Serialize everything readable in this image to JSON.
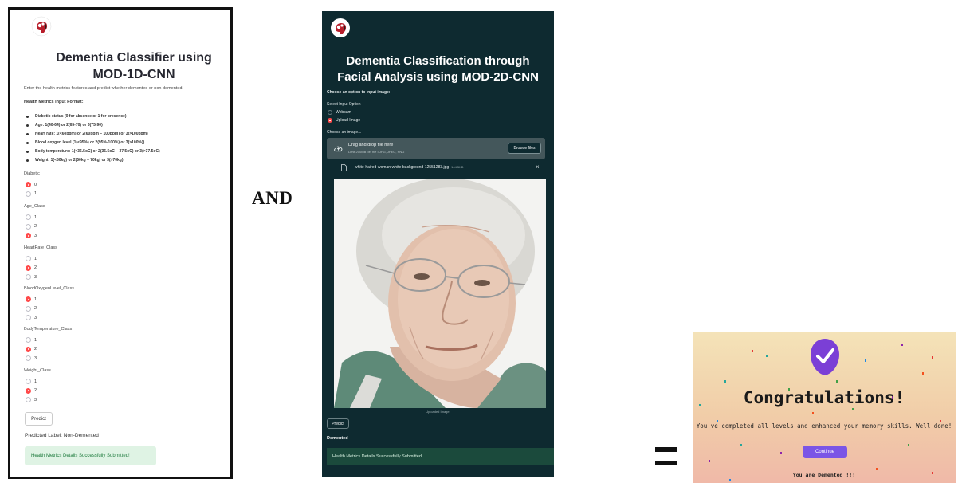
{
  "and_text": "AND",
  "left": {
    "title_line1": "Dementia Classifier using",
    "title_line2": "MOD-1D-CNN",
    "intro": "Enter the health metrics features and predict whether demented or non demented.",
    "format_heading": "Health Metrics Input Format:",
    "format_items": [
      "Diabetic status (0 for absence or 1 for presence)",
      "Age: 1(40-64) or 2(65-70) or 3(75-90)",
      "Heart rate: 1(<60bpm) or 2(60bpm – 100bpm) or 3(>100bpm)",
      "Blood oxygen level (1(<95%) or 2(95%-100%) or 3(>100%))",
      "Body temperature: 1(<36.5oC) or 2(36.5oC – 37.5oC) or 3(>37.5oC)",
      "Weight: 1(<50kg) or 2(50kg – 70kg) or 3(>70kg)"
    ],
    "groups": [
      {
        "label": "Diabetic",
        "options": [
          "0",
          "1"
        ],
        "selected": 0
      },
      {
        "label": "Age_Class",
        "options": [
          "1",
          "2",
          "3"
        ],
        "selected": 2
      },
      {
        "label": "HeartRate_Class",
        "options": [
          "1",
          "2",
          "3"
        ],
        "selected": 1
      },
      {
        "label": "BloodOxygenLevel_Class",
        "options": [
          "1",
          "2",
          "3"
        ],
        "selected": 0
      },
      {
        "label": "BodyTemperature_Class",
        "options": [
          "1",
          "2",
          "3"
        ],
        "selected": 1
      },
      {
        "label": "Weight_Class",
        "options": [
          "1",
          "2",
          "3"
        ],
        "selected": 1
      }
    ],
    "predict_label": "Predict",
    "predicted_label": "Predicted Label: Non-Demented",
    "success_message": "Health Metrics Details Successfully Submitted!"
  },
  "middle": {
    "title_line1": "Dementia Classification through",
    "title_line2": "Facial Analysis using MOD-2D-CNN",
    "choose_option": "Choose an option to input image:",
    "select_input": "Select Input Option",
    "options": [
      "Webcam",
      "Upload Image"
    ],
    "selected_option": 1,
    "choose_image": "Choose an image...",
    "dropzone_title": "Drag and drop file here",
    "dropzone_sub": "Limit 200MB per file • JPG, JPEG, PNG",
    "browse_label": "Browse files",
    "file_name": "white-haired-woman-white-background-12551283.jpg",
    "file_size": "144.5KB",
    "caption": "Uploaded Image.",
    "predict_label": "Predict",
    "result_label": "Demented",
    "success_message": "Health Metrics Details Successfully Submitted!"
  },
  "right": {
    "congrats": "Congratulations!",
    "completed": "You've completed all levels and enhanced your memory skills. Well done!",
    "continue_label": "Continue",
    "result": "You are Demented !!!"
  },
  "colors": {
    "accent_red": "#ff4b4b",
    "dark_panel": "#0e2a30",
    "purple": "#7b55e6",
    "success_green_bg": "#dff3e4"
  },
  "icons": [
    "logo-icon",
    "cloud-upload-icon",
    "file-icon",
    "close-icon",
    "check-badge-icon"
  ]
}
